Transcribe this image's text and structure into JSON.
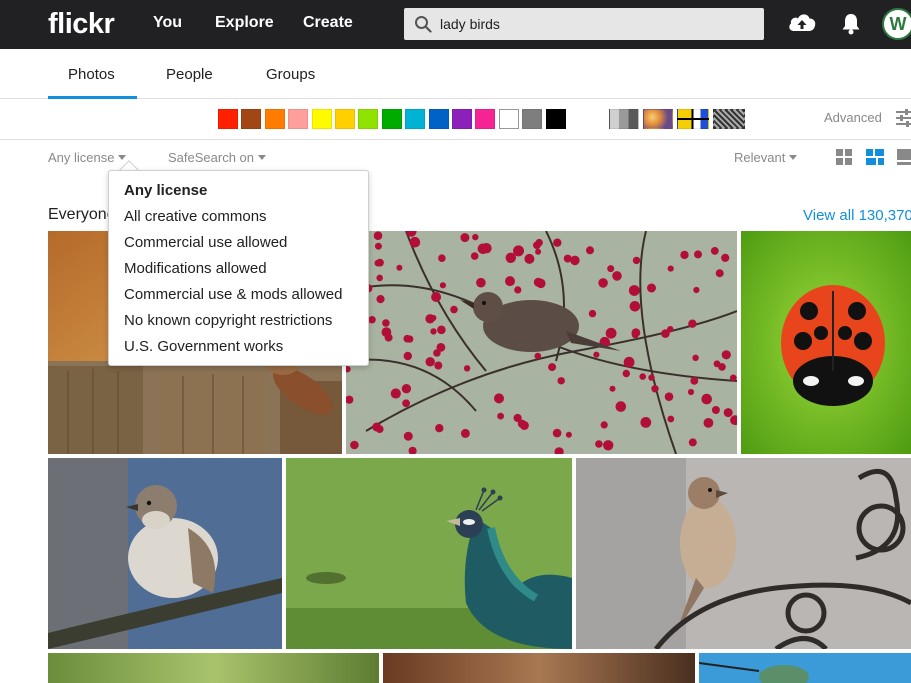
{
  "header": {
    "logo": "flickr",
    "nav": [
      "You",
      "Explore",
      "Create"
    ],
    "search_value": "lady birds",
    "avatar_letter": "W"
  },
  "tabs": [
    {
      "label": "Photos",
      "active": true
    },
    {
      "label": "People",
      "active": false
    },
    {
      "label": "Groups",
      "active": false
    }
  ],
  "color_filters": [
    "#ff2000",
    "#a24615",
    "#ff7c00",
    "#ff9f9c",
    "#fffa00",
    "#ffcf00",
    "#90e200",
    "#00ab00",
    "#00b2d4",
    "#0062c6",
    "#8c20ba",
    "#f52394",
    "#ffffff",
    "#7e7e7e",
    "#000000"
  ],
  "style_filters": [
    "black-and-white",
    "shallow-depth-of-field",
    "minimalist",
    "patterns"
  ],
  "advanced_label": "Advanced",
  "filters": {
    "license": "Any license",
    "safesearch": "SafeSearch on",
    "sort": "Relevant"
  },
  "license_dropdown": {
    "items": [
      "Any license",
      "All creative commons",
      "Commercial use allowed",
      "Modifications allowed",
      "Commercial use & mods allowed",
      "No known copyright restrictions",
      "U.S. Government works"
    ],
    "selected": "Any license"
  },
  "section": {
    "title": "Everyone",
    "view_all": "View all 130,370"
  }
}
